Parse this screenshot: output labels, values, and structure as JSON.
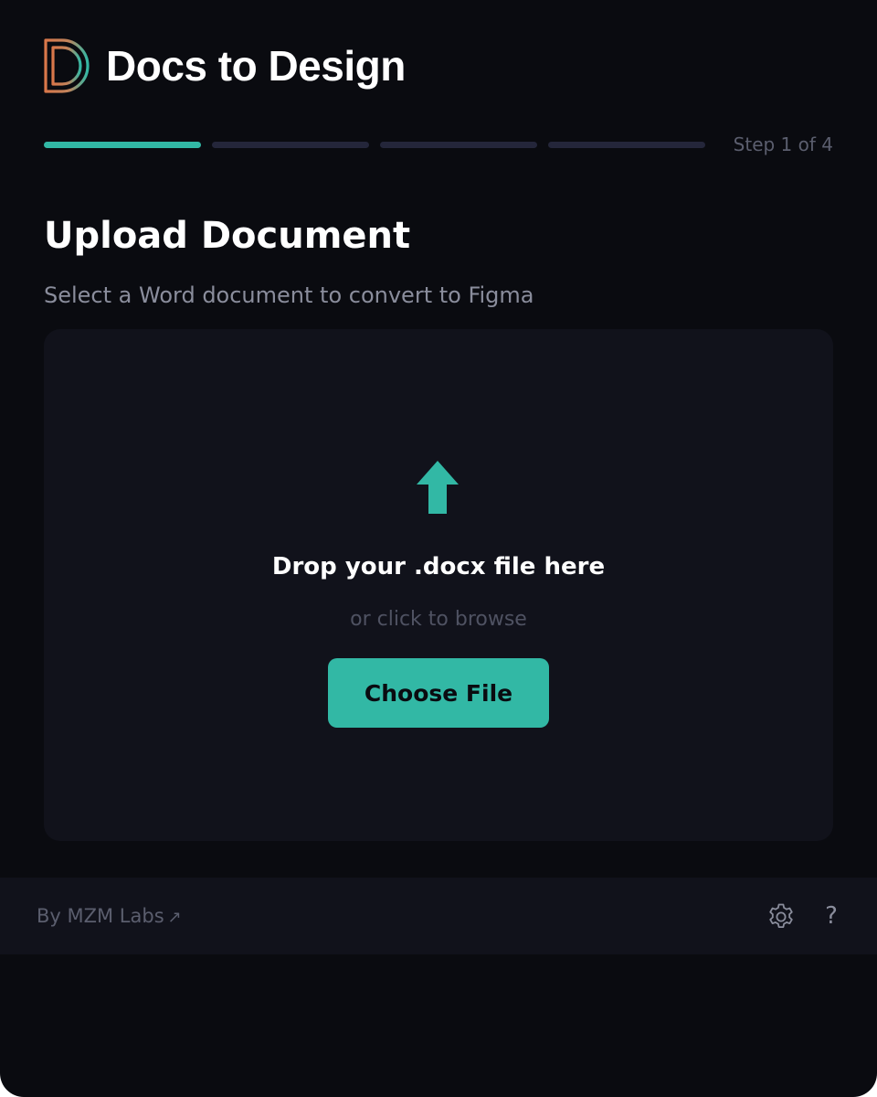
{
  "app": {
    "title": "Docs to Design",
    "logo_icon": "docs-to-design-d-logo-icon"
  },
  "progress": {
    "current_step": 1,
    "total_steps": 4,
    "label": "Step 1 of 4"
  },
  "main": {
    "heading": "Upload Document",
    "subtitle": "Select a Word document to convert to Figma"
  },
  "dropzone": {
    "icon": "upload-arrow-icon",
    "title": "Drop your .docx file here",
    "subtitle": "or click to browse",
    "button_label": "Choose File"
  },
  "footer": {
    "credit_label": "By MZM Labs",
    "credit_icon": "external-link-arrow-icon",
    "credit_icon_glyph": "↗",
    "settings_icon": "gear-icon",
    "help_icon": "help-icon",
    "help_glyph": "?"
  },
  "colors": {
    "background": "#0a0b10",
    "panel": "#11121b",
    "accent": "#32b8a5",
    "inactive_segment": "#24263a",
    "logo_orange": "#d9774a",
    "logo_teal": "#32b8a5",
    "muted_text": "#5b5e6e",
    "secondary_text": "#8a8d9c"
  }
}
